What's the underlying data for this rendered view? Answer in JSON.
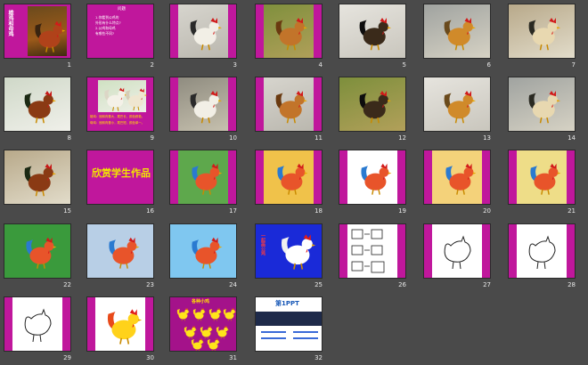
{
  "colors": {
    "magenta": "#c0179c",
    "magenta_dark": "#a4128a",
    "background": "#4a4a4a",
    "slide_number": "#e8e8e8",
    "title_yellow": "#f2e600"
  },
  "slides": [
    {
      "number": "1",
      "kind": "magenta-photo",
      "icon": "rooster-photo",
      "text": "雄鸡和母鸡"
    },
    {
      "number": "2",
      "kind": "magenta-text",
      "icon": "none",
      "heading": "问题",
      "lines": [
        "1.你看到公鸡的",
        "  外形有什么特点?",
        "2.公鸡和母鸡",
        "  有哪些不同?"
      ]
    },
    {
      "number": "3",
      "kind": "photo",
      "icon": "man-with-rooster-photo"
    },
    {
      "number": "4",
      "kind": "photo",
      "icon": "children-with-chicken-photo"
    },
    {
      "number": "5",
      "kind": "photo",
      "icon": "rooster-photo"
    },
    {
      "number": "6",
      "kind": "photo",
      "icon": "hens-photo"
    },
    {
      "number": "7",
      "kind": "photo",
      "icon": "rooster-photo"
    },
    {
      "number": "8",
      "kind": "photo",
      "icon": "hen-photo"
    },
    {
      "number": "9",
      "kind": "magenta-photo",
      "icon": "chickens-photo",
      "lines": [
        "雄鸡：冠和肉垂大，尾巴长，颜色鲜艳。",
        "母鸡：冠和肉垂小，尾巴短，颜色单一。"
      ]
    },
    {
      "number": "10",
      "kind": "photo",
      "icon": "rooster-photo"
    },
    {
      "number": "11",
      "kind": "photo",
      "icon": "leaf-rooster-photo"
    },
    {
      "number": "12",
      "kind": "photo",
      "icon": "rooster-photo"
    },
    {
      "number": "13",
      "kind": "photo",
      "icon": "rooster-photo"
    },
    {
      "number": "14",
      "kind": "photo",
      "icon": "rooster-photo"
    },
    {
      "number": "15",
      "kind": "photo",
      "icon": "rooster-photo"
    },
    {
      "number": "16",
      "kind": "magenta-title",
      "icon": "none",
      "text": "欣赏学生作品"
    },
    {
      "number": "17",
      "kind": "drawing",
      "icon": "peacock-drawing"
    },
    {
      "number": "18",
      "kind": "drawing",
      "icon": "roosters-drawing"
    },
    {
      "number": "19",
      "kind": "drawing",
      "icon": "rooster-drawing"
    },
    {
      "number": "20",
      "kind": "drawing",
      "icon": "rooster-drawing"
    },
    {
      "number": "21",
      "kind": "drawing",
      "icon": "rooster-drawing"
    },
    {
      "number": "22",
      "kind": "drawing",
      "icon": "rooster-drawing"
    },
    {
      "number": "23",
      "kind": "drawing",
      "icon": "rooster-drawing"
    },
    {
      "number": "24",
      "kind": "drawing",
      "icon": "chick-drawing"
    },
    {
      "number": "25",
      "kind": "blue-cartoon",
      "icon": "rooster-cartoon",
      "text": "一起画公鸡"
    },
    {
      "number": "26",
      "kind": "steps",
      "icon": "drawing-steps"
    },
    {
      "number": "27",
      "kind": "lineart",
      "icon": "hen-lineart"
    },
    {
      "number": "28",
      "kind": "lineart",
      "icon": "rooster-lineart"
    },
    {
      "number": "29",
      "kind": "lineart",
      "icon": "chickens-lineart"
    },
    {
      "number": "30",
      "kind": "cartoon",
      "icon": "rooster-cartoon"
    },
    {
      "number": "31",
      "kind": "magenta-chicks",
      "icon": "chicks-cartoon",
      "text": "各种小鸡"
    },
    {
      "number": "32",
      "kind": "ppt-ad",
      "icon": "ppt-logo",
      "text": "第1PPT"
    }
  ]
}
